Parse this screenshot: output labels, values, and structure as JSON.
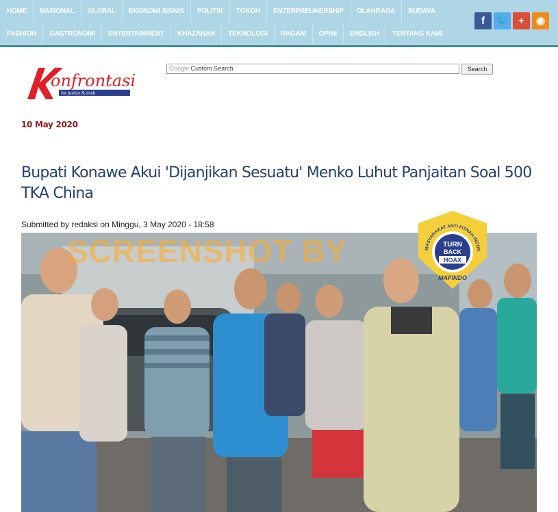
{
  "nav": {
    "row1": [
      "HOME",
      "NASIONAL",
      "GLOBAL",
      "EKONOMI BISNIS",
      "POLITIK",
      "TOKOH",
      "ENTERPREUNERSHIP",
      "OLAHRAGA",
      "BUDAYA"
    ],
    "row2": [
      "FASHION",
      "GASTRONOMI",
      "ENTERTAINMENT",
      "KHAZANAH",
      "TEKNOLOGI",
      "RAGAM",
      "OPINI",
      "ENGLISH",
      "TENTANG KAMI"
    ]
  },
  "social": [
    {
      "name": "facebook-icon",
      "glyph": "f",
      "color": "#3b5998"
    },
    {
      "name": "twitter-icon",
      "glyph": "🐦",
      "color": "#55acee"
    },
    {
      "name": "google-plus-icon",
      "glyph": "+",
      "color": "#dd4b39"
    },
    {
      "name": "rss-icon",
      "glyph": "◉",
      "color": "#f2891b"
    }
  ],
  "logo": {
    "text": "onfrontasi",
    "tagline": "for justice & truth"
  },
  "search": {
    "google_label": "Google",
    "placeholder": "Custom Search",
    "button": "Search"
  },
  "article": {
    "date": "10 May 2020",
    "title": "Bupati Konawe Akui 'Dijanjikan Sesuatu' Menko Luhut Panjaitan Soal 500 TKA China",
    "submitted": "Submitted by redaksi on Minggu, 3 May 2020 - 18:58"
  },
  "watermark": "SCREENSHOT BY",
  "badge": {
    "ring_text": "MASYARAKAT ANTI FITNAH INDONESIA",
    "center_line1": "TURN",
    "center_line2": "BACK",
    "center_line3": "HOAX",
    "bottom": "MAFINDO"
  },
  "colors": {
    "nav_bg": "#aed6e6",
    "title": "#24406e",
    "date": "#8b1a1a",
    "logo_red": "#e01f26",
    "badge_gold": "#f5cf3a",
    "badge_blue": "#2b3f8e"
  }
}
